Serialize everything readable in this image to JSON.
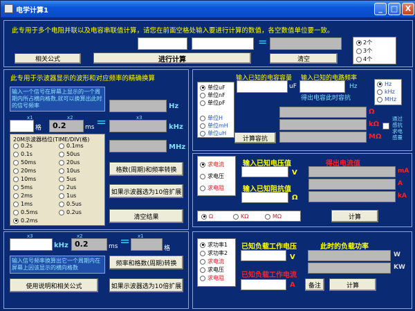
{
  "window": {
    "title": "电学计算1",
    "min": "_",
    "max": "□",
    "close": "X"
  },
  "top": {
    "description": "此专用于多个电阻并联以及电容串联值计算，请您在前面空格处输入要进行计算的数值，各空数值单位要一致。",
    "equals": "=",
    "related_formula": "相关公式",
    "calculate": "进行计算",
    "clear": "清空",
    "count_options": [
      "2个",
      "3个",
      "4个"
    ],
    "count_selected": 0
  },
  "osc": {
    "description": "此专用于示波器显示的波形和对应频率的精确换算",
    "info1": "输入一个信号在屏幕上显示的一个周期内所占横向格数,就可以换算出此时的信号频率",
    "hz": "Hz",
    "khz": "kHz",
    "mhz": "MHz",
    "x1": "x1",
    "x2": "x2",
    "x3": "x3",
    "ge": "格",
    "value": "0.2",
    "ms": "ms",
    "equals": "=",
    "timebase_title": "20M示波器档位(TIME/DIV(格)",
    "timebase_left": [
      "0.2s",
      "0.1s",
      "50ms",
      "20ms",
      "10ms",
      "5ms",
      "2ms",
      "1ms",
      "0.5ms",
      "0.2ms"
    ],
    "timebase_right": [
      "0.1ms",
      "50us",
      "20us",
      "10us",
      "5us",
      "2us",
      "1us",
      "0.5us",
      "0.2us"
    ],
    "timebase_selected": "0.2ms",
    "btn_convert": "格数(周期)和频率转换",
    "btn_expand": "如果示波器选为10倍扩展",
    "btn_clear": "清空结果"
  },
  "bottom_left": {
    "x3": "x3",
    "x2": "x2",
    "x1": "x1",
    "khz": "kHz",
    "value": "0.2",
    "ms": "ms",
    "equals": "=",
    "info": "输入信号频率换算出它一个周期内在屏幕上因该显示的横向格数",
    "btn_convert": "频率和格数(周期)转换",
    "btn_help": "使用说明和相关公式",
    "btn_expand": "如果示波器选为10倍扩展"
  },
  "capacitor": {
    "label_cap": "输入已知的电容容量",
    "label_freq": "输入已知的电路频率",
    "uf": "uF",
    "hz": "Hz",
    "result_label": "得出电容此时容抗",
    "units_left": [
      "单位uF",
      "单位nF",
      "单位pF",
      "单位H",
      "单位mH",
      "单位uH"
    ],
    "units_left_selected": 0,
    "units_right": [
      "Hz",
      "kHz",
      "MHz"
    ],
    "units_right_selected": 0,
    "omega": "Ω",
    "komega": "kΩ",
    "momega": "MΩ",
    "btn_calc": "计算容抗",
    "inductor_label": "通过感抗求电感量"
  },
  "ohm": {
    "modes": [
      "求电流",
      "求电压",
      "求电阻"
    ],
    "mode_selected": 0,
    "label_voltage": "输入已知电压值",
    "label_resistance": "输入已知阻抗值",
    "result_label": "得出电流值",
    "v": "V",
    "omega": "Ω",
    "units": [
      "mA",
      "A",
      "kA"
    ],
    "resistance_units": [
      "Ω",
      "KΩ",
      "MΩ"
    ],
    "resistance_selected": 0,
    "btn_calc": "计算"
  },
  "power": {
    "modes": [
      "求功率1",
      "求功率2",
      "求电流",
      "求电压",
      "求电阻"
    ],
    "mode_selected": 0,
    "label_voltage": "已知负载工作电压",
    "label_current": "已知负载工作电流",
    "result_label": "此时的负载功率",
    "v": "V",
    "a": "A",
    "w": "W",
    "kw": "KW",
    "btn_note": "备注",
    "btn_calc": "计算"
  },
  "colors": {
    "background": "#0b2a74",
    "accent": "#ffff00",
    "warning": "#ff2020"
  }
}
